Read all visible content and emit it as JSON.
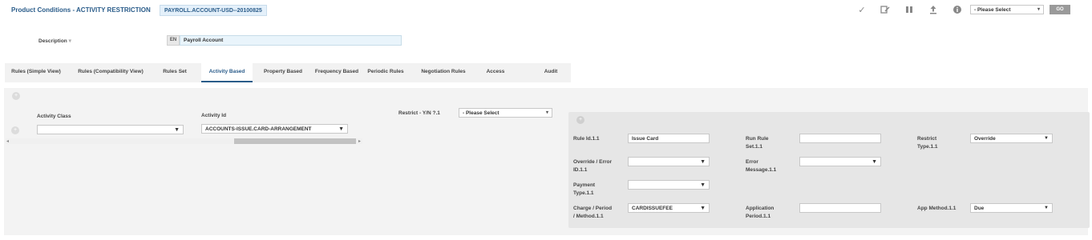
{
  "header": {
    "title": "Product Conditions - ACTIVITY RESTRICTION",
    "record_id": "PAYROLL.ACCOUNT-USD--20100825",
    "action_select": "- Please Select",
    "go_label": "GO",
    "icons": [
      "check-icon",
      "edit-icon",
      "pause-icon",
      "upload-icon",
      "info-icon"
    ]
  },
  "description": {
    "label": "Description",
    "marker": "▾",
    "lang": "EN",
    "value": "Payroll Account"
  },
  "tabs": [
    {
      "label": "Rules (Simple View)"
    },
    {
      "label": "Rules (Compatibility View)"
    },
    {
      "label": "Rules Set"
    },
    {
      "label": "Activity Based",
      "active": true
    },
    {
      "label": "Property Based"
    },
    {
      "label": "Frequency Based"
    },
    {
      "label": "Periodic Rules"
    },
    {
      "label": "Negotiation Rules"
    },
    {
      "label": "Access"
    },
    {
      "label": "Audit"
    }
  ],
  "activity": {
    "class_label": "Activity Class",
    "class_value": "",
    "id_label": "Activity Id",
    "id_value": "ACCOUNTS-ISSUE.CARD-ARRANGEMENT",
    "restrict_label": "Restrict - Y/N ?.1",
    "restrict_value": "- Please Select"
  },
  "rule": {
    "rule_id_label": "Rule Id.1.1",
    "rule_id_value": "Issue Card",
    "run_rule_label_1": "Run Rule",
    "run_rule_label_2": "Set.1.1",
    "run_rule_value": "",
    "restrict_type_label_1": "Restrict",
    "restrict_type_label_2": "Type.1.1",
    "restrict_type_value": "Override",
    "override_label_1": "Override / Error",
    "override_label_2": "ID.1.1",
    "override_value": "",
    "error_msg_label_1": "Error",
    "error_msg_label_2": "Message.1.1",
    "error_msg_value": "",
    "payment_type_label_1": "Payment",
    "payment_type_label_2": "Type.1.1",
    "payment_type_value": "",
    "charge_label_1": "Charge / Period",
    "charge_label_2": "/ Method.1.1",
    "charge_value": "CARDISSUEFEE",
    "app_period_label_1": "Application",
    "app_period_label_2": "Period.1.1",
    "app_period_value": "",
    "app_method_label": "App Method.1.1",
    "app_method_value": "Due"
  },
  "glyphs": {
    "dropdown": "▼",
    "small_dropdown": "▾",
    "plus": "+",
    "scroll_left": "◂",
    "scroll_right": "▸"
  }
}
